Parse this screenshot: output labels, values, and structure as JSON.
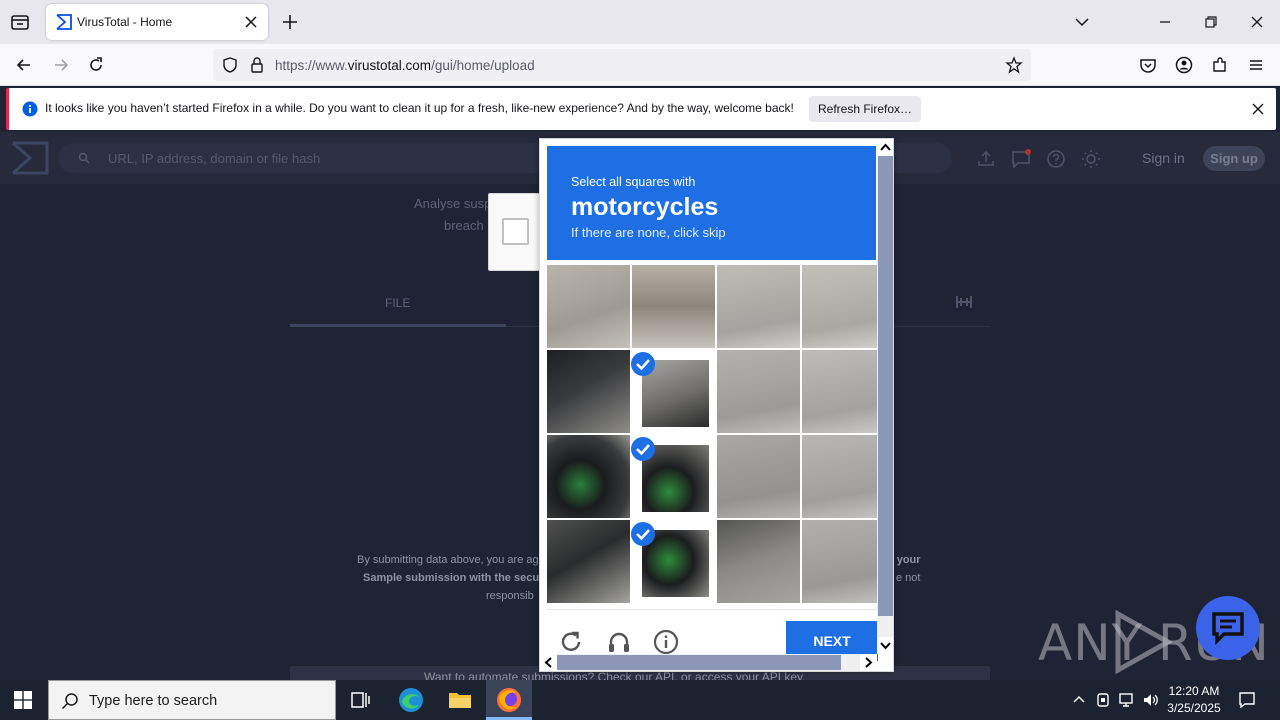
{
  "browser": {
    "tab_title": "VirusTotal - Home",
    "url_prefix": "https://www.",
    "url_domain": "virustotal.com",
    "url_path": "/gui/home/upload",
    "notification_text": "It looks like you haven’t started Firefox in a while. Do you want to clean it up for a fresh, like-new experience? And by the way, welcome back!",
    "notification_button": "Refresh Firefox…"
  },
  "vt": {
    "search_placeholder": "URL, IP address, domain or file hash",
    "sign_in": "Sign in",
    "sign_up": "Sign up",
    "analyse_text": "Analyse susp",
    "breach_text": "breach",
    "tab_file": "FILE",
    "terms_line1": "By submitting data above, you are ag",
    "terms_line2": "Sample submission with the secur",
    "terms_line3": "responsib",
    "terms_right1": "f your",
    "terms_right2": "e not",
    "automate_text": "Want to automate submissions? Check our API, or access your API key."
  },
  "captcha": {
    "instruction": "Select all squares with",
    "target": "motorcycles",
    "skip_hint": "If there are none, click skip",
    "next_button": "NEXT",
    "accent": "#1e6fe3",
    "selected_cells": [
      5,
      9,
      13
    ]
  },
  "watermark": {
    "text_any": "ANY",
    "text_run": "RUN"
  },
  "taskbar": {
    "search_placeholder": "Type here to search",
    "time": "12:20 AM",
    "date": "3/25/2025"
  }
}
